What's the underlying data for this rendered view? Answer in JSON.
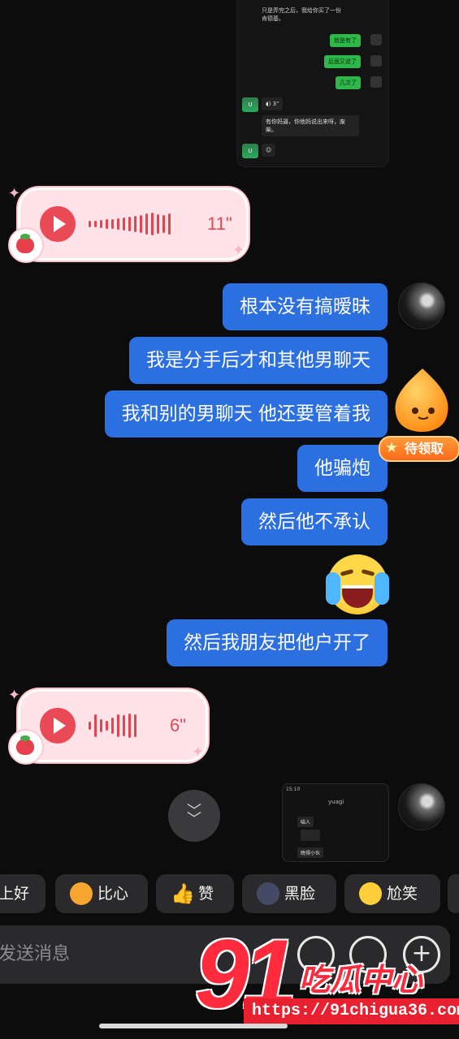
{
  "embedded_top": {
    "lines": [
      "只是弄完之后，我给你买了一份",
      "肯德基。"
    ],
    "sent": [
      "就是有了",
      "后面又说了",
      "几次了"
    ],
    "voice_label": "3\"",
    "received_text": [
      "有你妈逼，你他妈说出来呀，废",
      "柴。"
    ],
    "avatar_label": "U"
  },
  "voice_messages": [
    {
      "duration": "11\""
    },
    {
      "duration": "6\""
    }
  ],
  "messages": [
    {
      "text": "根本没有搞暧昧"
    },
    {
      "text": "我是分手后才和其他男聊天"
    },
    {
      "text": "我和别的男聊天 他还要管着我"
    },
    {
      "text": "他骗炮"
    },
    {
      "text": "然后他不承认"
    },
    {
      "text": "然后我朋友把他户开了"
    }
  ],
  "reward_badge": "待领取",
  "embedded_bottom": {
    "time": "15:10",
    "name": "yuagi",
    "items": [
      "喵人",
      "晚得小伙"
    ]
  },
  "quick_replies": [
    "上好",
    "比心",
    "赞",
    "黑脸",
    "尬笑"
  ],
  "input": {
    "placeholder": "发送消息"
  },
  "watermark": {
    "big": "91",
    "name": "吃瓜中心",
    "url": "https://91chigua36.com"
  },
  "colors": {
    "bubble": "#2b6fe0",
    "chip": "#2a2a2c",
    "background": "#0c0c0d"
  }
}
